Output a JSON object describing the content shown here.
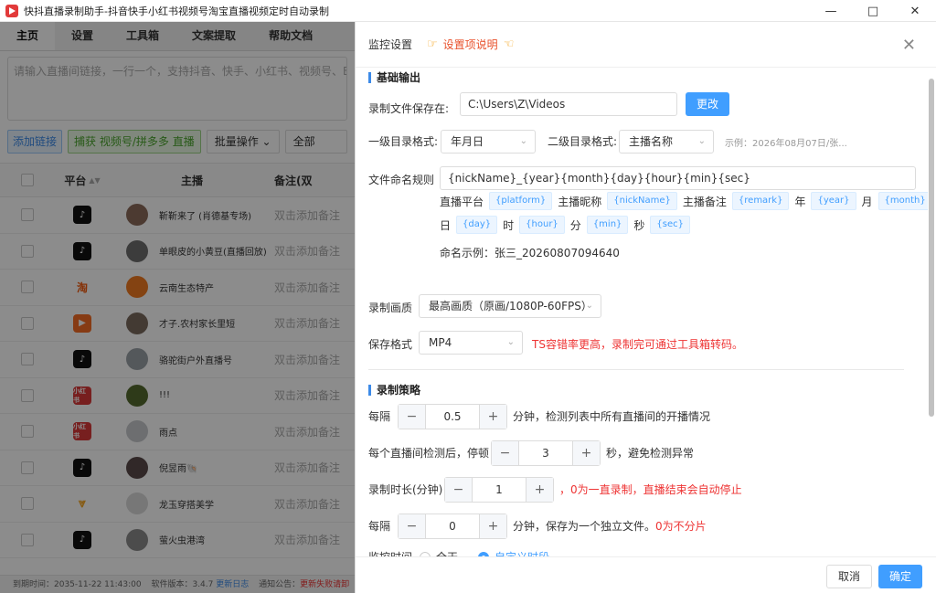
{
  "window": {
    "title": "快抖直播录制助手-抖音快手小红书视频号淘宝直播视频定时自动录制"
  },
  "tabs": [
    "主页",
    "设置",
    "工具箱",
    "文案提取",
    "帮助文档"
  ],
  "url_input": {
    "placeholder": "请输入直播间链接，一行一个，支持抖音、快手、小红书、视频号、Bilibili、淘宝"
  },
  "toolbar": {
    "add_link": "添加链接",
    "capture": "捕获 视频号/拼多多 直播",
    "batch": "批量操作",
    "filter": "全部"
  },
  "table": {
    "headers": [
      "平台",
      "主播",
      "备注(双"
    ],
    "rows": [
      {
        "platform": "douyin",
        "host": "靳靳来了 (肖德基专场)",
        "note": "双击添加备注"
      },
      {
        "platform": "douyin",
        "host": "单眼皮的小黄豆(直播回放)",
        "note": "双击添加备注"
      },
      {
        "platform": "taobao",
        "host": "云南生态特产",
        "note": "双击添加备注"
      },
      {
        "platform": "kuaishou",
        "host": "才子.农村家长里短",
        "note": "双击添加备注"
      },
      {
        "platform": "douyin",
        "host": "骆驼街户外直播号",
        "note": "双击添加备注"
      },
      {
        "platform": "hongshu",
        "host": "!!!",
        "note": "双击添加备注"
      },
      {
        "platform": "hongshu",
        "host": "雨点",
        "note": "双击添加备注"
      },
      {
        "platform": "douyin",
        "host": "倪昱雨🐚",
        "note": "双击添加备注"
      },
      {
        "platform": "ks",
        "host": "龙玉穿搭美学",
        "note": "双击添加备注"
      },
      {
        "platform": "douyin",
        "host": "萤火虫港湾",
        "note": "双击添加备注"
      }
    ]
  },
  "statusbar": {
    "expire": "到期时间：2035-11-22 11:43:00",
    "version": "软件版本：3.4.7",
    "changelog": "更新日志",
    "notice": "通知公告：",
    "notice_text": "更新失败请卸"
  },
  "panel": {
    "title": "监控设置",
    "help": "设置项说明",
    "section_output": "基础输出",
    "save_label": "录制文件保存在:",
    "save_path": "C:\\Users\\Z\\Videos",
    "change_btn": "更改",
    "dir1_label": "一级目录格式:",
    "dir1_value": "年月日",
    "dir2_label": "二级目录格式:",
    "dir2_value": "主播名称",
    "dir_example": "示例：2026年08月07日/张...",
    "naming_label": "文件命名规则",
    "naming_value": "{nickName}_{year}{month}{day}{hour}{min}{sec}",
    "naming_tags": [
      {
        "label": "直播平台",
        "tag": "{platform}"
      },
      {
        "label": "主播昵称",
        "tag": "{nickName}"
      },
      {
        "label": "主播备注",
        "tag": "{remark}"
      },
      {
        "label": "年",
        "tag": "{year}"
      },
      {
        "label": "月",
        "tag": "{month}"
      },
      {
        "label": "日",
        "tag": "{day}"
      },
      {
        "label": "时",
        "tag": "{hour}"
      },
      {
        "label": "分",
        "tag": "{min}"
      },
      {
        "label": "秒",
        "tag": "{sec}"
      }
    ],
    "naming_example": "命名示例：张三_20260807094640",
    "quality_label": "录制画质",
    "quality_value": "最高画质（原画/1080P-60FPS）",
    "format_label": "保存格式",
    "format_value": "MP4",
    "format_warning": "TS容错率更高，录制完可通过工具箱转码。",
    "section_strategy": "录制策略",
    "interval_label": "每隔",
    "interval_value": "0.5",
    "interval_text": "分钟，检测列表中所有直播间的开播情况",
    "pause_label": "每个直播间检测后，停顿",
    "pause_value": "3",
    "pause_text": "秒，避免检测异常",
    "duration_label": "录制时长(分钟)",
    "duration_value": "1",
    "duration_text": "，0为一直录制，直播结束会自动停止",
    "split_label": "每隔",
    "split_value": "0",
    "split_text": "分钟，保存为一个独立文件。",
    "split_red": "0为不分片",
    "monitor_label": "监控时间",
    "monitor_opt1": "全天",
    "monitor_opt2": "自定义时段",
    "cancel": "取消",
    "confirm": "确定"
  }
}
